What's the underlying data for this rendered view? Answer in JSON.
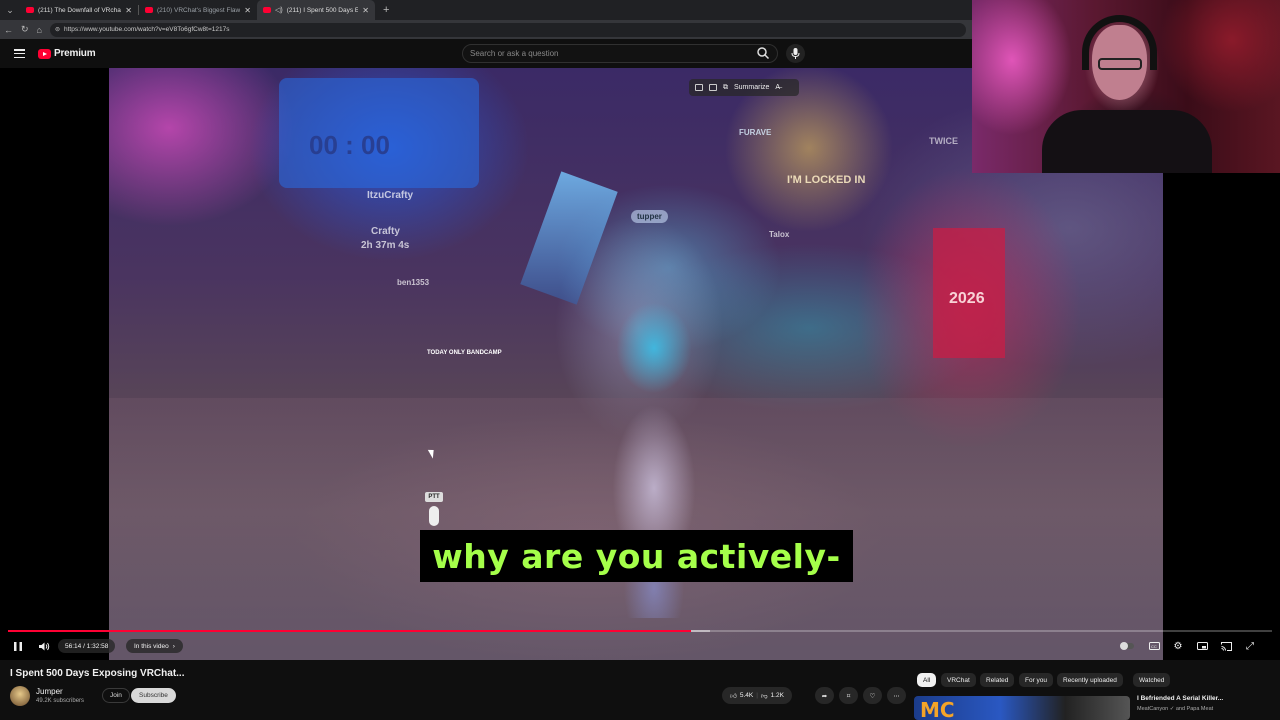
{
  "browser": {
    "tabs": [
      {
        "title": "(211) The Downfall of VRchat - Yo",
        "active": false
      },
      {
        "title": "(210) VRChat's Biggest Flaw - You",
        "active": false
      },
      {
        "title": "(211) I Spent 500 Days Exposi",
        "active": true
      }
    ],
    "url": "https://www.youtube.com/watch?v=eV8To6gfCw8t=1217s"
  },
  "header": {
    "logo_text": "Premium",
    "search_placeholder": "Search or ask a question"
  },
  "player": {
    "ai_summarize": "Summarize",
    "caption": "why are you actively-",
    "ptt": "PTT",
    "current_time": "56:14",
    "duration": "1:32:58",
    "time_display": "56:14 / 1:32:58",
    "chapter_label": "In this video",
    "progress_fraction": 0.54,
    "buffer_fraction": 0.555,
    "scene_labels": {
      "big_sign": "00 : 00",
      "crafty": "Crafty",
      "timer": "2h 37m 4s",
      "itzucrafty": "ItzuCrafty",
      "ben": "ben1353",
      "tupper": "tupper",
      "talox": "Talox",
      "locked": "I'M LOCKED IN",
      "furave": "FURAVE",
      "year": "2026",
      "today": "TODAY ONLY BANDCAMP",
      "twice": "TWICE"
    }
  },
  "video": {
    "title": "I Spent 500 Days Exposing VRChat...",
    "channel": "Jumper",
    "subscribers": "49.2K subscribers",
    "join_label": "Join",
    "subscribe_label": "Subscribe",
    "likes": "5.4K",
    "dislikes": "1.2K"
  },
  "chips": [
    "All",
    "VRChat",
    "Related",
    "For you",
    "Recently uploaded",
    "Watched"
  ],
  "recommended": {
    "title": "I Befriended A Serial Killer...",
    "channel": "MeatCanyon ✓ and Papa Meat",
    "thumb_text": "MC"
  },
  "colors": {
    "accent": "#ff0033",
    "caption_text": "#a5ff4a",
    "background": "#0f0f0f"
  }
}
